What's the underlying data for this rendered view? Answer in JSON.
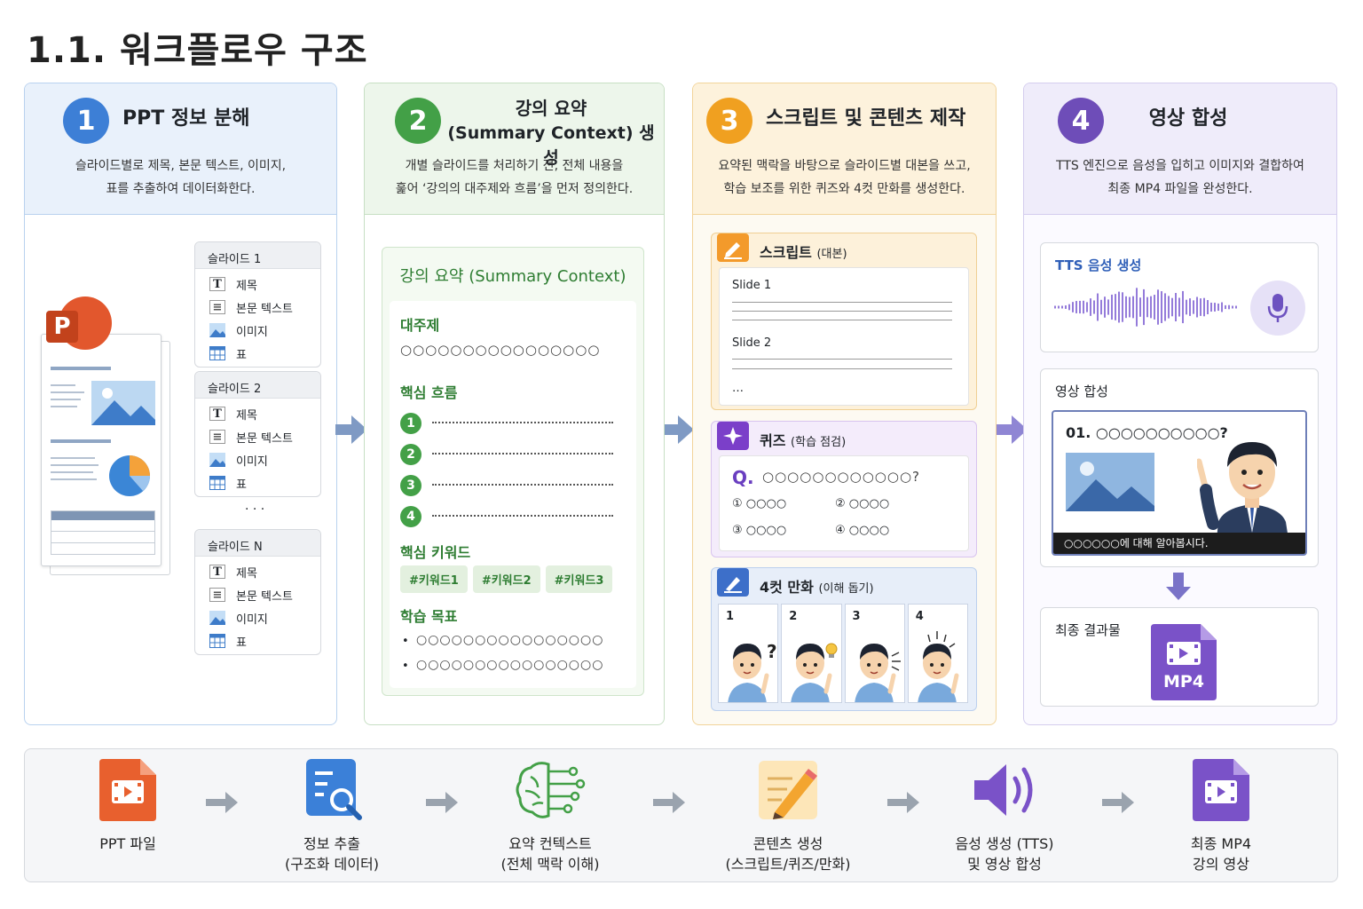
{
  "page_title": "1.1. 워크플로우 구조",
  "colors": {
    "blue": "#3d7fd6",
    "green": "#43a047",
    "orange": "#f0a020",
    "purple": "#6e4db8"
  },
  "step1": {
    "num": "1",
    "title": "PPT 정보 분해",
    "desc1": "슬라이드별로 제목, 본문 텍스트, 이미지,",
    "desc2": "표를 추출하여 데이터화한다.",
    "ppt_letter": "P",
    "slides": [
      {
        "name": "슬라이드 1"
      },
      {
        "name": "슬라이드 2"
      },
      {
        "name": "슬라이드 N"
      }
    ],
    "items": [
      "제목",
      "본문 텍스트",
      "이미지",
      "표"
    ],
    "ellipsis": "· · ·"
  },
  "step2": {
    "num": "2",
    "title_line1": "강의 요약",
    "title_line2": "(Summary Context) 생성",
    "desc1": "개별 슬라이드를 처리하기 전, 전체 내용을",
    "desc2": "훑어 ‘강의의 대주제와 흐름’을 먼저 정의한다.",
    "card_title": "강의 요약 (Summary Context)",
    "topic_label": "대주제",
    "topic_value": "○○○○○○○○○○○○○○○○",
    "flow_label": "핵심 흐름",
    "flow_nums": [
      "1",
      "2",
      "3",
      "4"
    ],
    "keyword_label": "핵심 키워드",
    "keywords": [
      "#키워드1",
      "#키워드2",
      "#키워드3"
    ],
    "goal_label": "학습 목표",
    "goals": [
      "○○○○○○○○○○○○○○○○",
      "○○○○○○○○○○○○○○○○"
    ]
  },
  "step3": {
    "num": "3",
    "title": "스크립트 및 콘텐츠 제작",
    "desc1": "요약된 맥락을 바탕으로 슬라이드별 대본을 쓰고,",
    "desc2": "학습 보조를 위한 퀴즈와 4컷 만화를 생성한다.",
    "script_title": "스크립트",
    "script_sub": "(대본)",
    "slide1": "Slide 1",
    "slide2": "Slide 2",
    "script_more": "…",
    "quiz_title": "퀴즈",
    "quiz_sub": "(학습 점검)",
    "quiz_q": "Q.",
    "quiz_text": "○○○○○○○○○○○○?",
    "quiz_options": [
      "① ○○○○",
      "② ○○○○",
      "③ ○○○○",
      "④ ○○○○"
    ],
    "comic_title": "4컷 만화",
    "comic_sub": "(이해 돕기)",
    "panels": [
      "1",
      "2",
      "3",
      "4"
    ]
  },
  "step4": {
    "num": "4",
    "title": "영상 합성",
    "desc1": "TTS 엔진으로 음성을 입히고 이미지와 결합하여",
    "desc2": "최종 MP4 파일을 완성한다.",
    "tts_title": "TTS 음성 생성",
    "video_title": "영상 합성",
    "video_q": "01. ○○○○○○○○○○?",
    "subtitle": "○○○○○○에 대해 알아봅시다.",
    "result_title": "최종 결과물",
    "mp4": "MP4"
  },
  "bottom": [
    {
      "l1": "PPT 파일",
      "l2": ""
    },
    {
      "l1": "정보 추출",
      "l2": "(구조화 데이터)"
    },
    {
      "l1": "요약 컨텍스트",
      "l2": "(전체 맥락 이해)"
    },
    {
      "l1": "콘텐츠 생성",
      "l2": "(스크립트/퀴즈/만화)"
    },
    {
      "l1": "음성 생성 (TTS)",
      "l2": "및 영상 합성"
    },
    {
      "l1": "최종 MP4",
      "l2": "강의 영상"
    }
  ]
}
